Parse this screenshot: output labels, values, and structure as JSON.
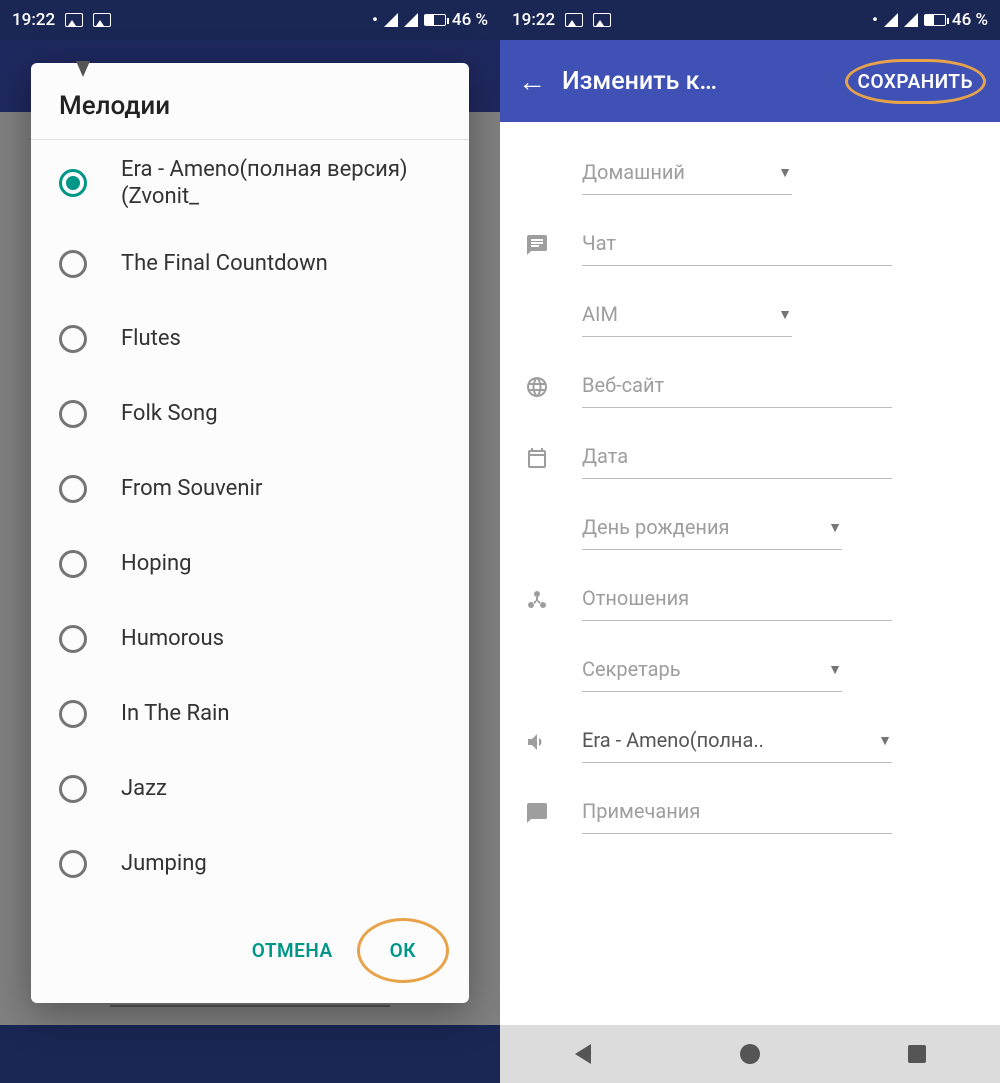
{
  "status": {
    "time": "19:22",
    "battery_text": "46 %"
  },
  "left": {
    "dialog_title": "Мелодии",
    "options": [
      "Era - Ameno(полная версия) (Zvonit_",
      "The Final Countdown",
      "Flutes",
      "Folk Song",
      "From Souvenir",
      "Hoping",
      "Humorous",
      "In The Rain",
      "Jazz",
      "Jumping"
    ],
    "selected_index": 0,
    "cancel": "ОТМЕНА",
    "ok": "ОК"
  },
  "right": {
    "appbar_title": "Изменить к…",
    "save": "СОХРАНИТЬ",
    "fields": {
      "home_type": "Домашний",
      "chat": "Чат",
      "chat_type": "AIM",
      "website": "Веб-сайт",
      "date": "Дата",
      "date_type": "День рождения",
      "relation": "Отношения",
      "relation_type": "Секретарь",
      "ringtone": "Era - Ameno(полна..",
      "notes": "Примечания"
    }
  }
}
